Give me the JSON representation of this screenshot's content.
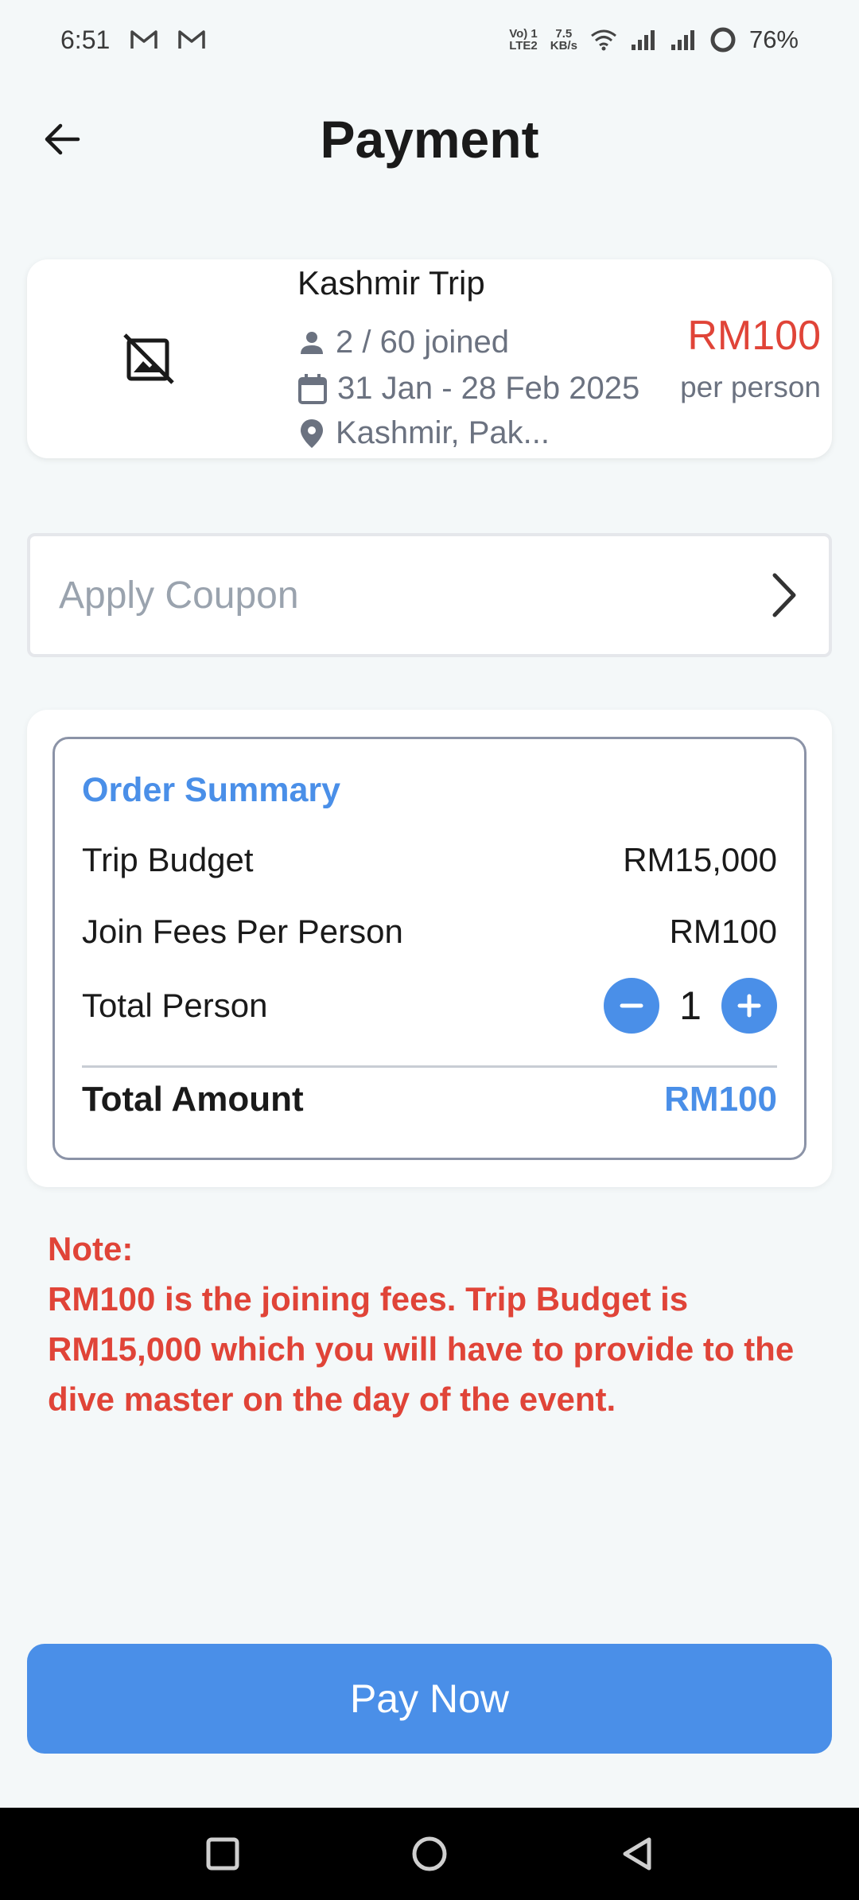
{
  "status_bar": {
    "time": "6:51",
    "network_top": "Vo) 1",
    "network_bottom": "LTE2",
    "speed_top": "7.5",
    "speed_bottom": "KB/s",
    "battery": "76%",
    "icons": [
      "gmail-icon",
      "gmail-icon",
      "wifi-icon",
      "signal-icon",
      "signal-icon",
      "battery-icon"
    ]
  },
  "header": {
    "title": "Payment",
    "back_icon": "arrow-left-icon"
  },
  "trip": {
    "title": "Kashmir Trip",
    "joined": "2 / 60 joined",
    "dates": "31 Jan - 28 Feb 2025",
    "location": "Kashmir, Pak...",
    "price": "RM100",
    "price_unit": "per person",
    "image_icon": "broken-image-icon"
  },
  "coupon": {
    "placeholder": "Apply Coupon"
  },
  "order_summary": {
    "heading": "Order Summary",
    "trip_budget_label": "Trip Budget",
    "trip_budget_value": "RM15,000",
    "join_fees_label": "Join Fees Per Person",
    "join_fees_value": "RM100",
    "total_person_label": "Total Person",
    "total_person_value": "1",
    "total_amount_label": "Total Amount",
    "total_amount_value": "RM100"
  },
  "note": {
    "title": "Note:",
    "text": "RM100 is the joining fees. Trip Budget is RM15,000 which you will have to provide to the dive master on the day of the event."
  },
  "pay_button": {
    "label": "Pay Now"
  },
  "colors": {
    "accent": "#4a8fe8",
    "price_red": "#e04438",
    "background": "#f4f8f9"
  }
}
